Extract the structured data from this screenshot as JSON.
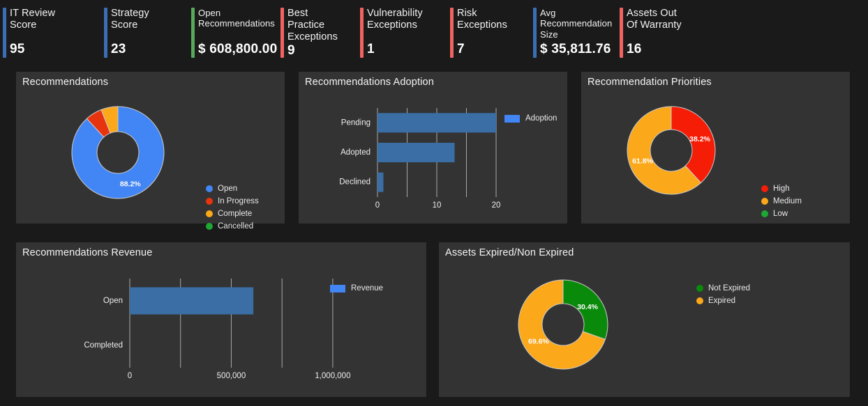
{
  "colors": {
    "page_bg": "#1a1a1a",
    "panel_bg": "#333333",
    "accent_blue": "#3b6fb5",
    "accent_green": "#5aa85a",
    "accent_red": "#ef6361",
    "bar_blue": "#3a6ea5",
    "legend_blue": "#4285f4",
    "legend_red": "#e8330f",
    "legend_orange": "#fba81a",
    "legend_green": "#1da834",
    "donut_green": "#0a8a0a",
    "grid": "#a8a8a8",
    "text": "#ededed"
  },
  "kpis": [
    {
      "label": "IT Review\nScore",
      "value": "95",
      "accent": "#3b6fb5",
      "label_size": "lg",
      "width": 145
    },
    {
      "label": "Strategy\nScore",
      "value": "23",
      "accent": "#3b6fb5",
      "label_size": "lg",
      "width": 125
    },
    {
      "label": "Open\nRecommendations",
      "value": "$ 608,800.00",
      "accent": "#5aa85a",
      "label_size": "sm",
      "width": 128
    },
    {
      "label": "Best\nPractice\nExceptions",
      "value": "9",
      "accent": "#ef6361",
      "label_size": "lg",
      "width": 114
    },
    {
      "label": "Vulnerability\nExceptions",
      "value": "1",
      "accent": "#ef6361",
      "label_size": "lg",
      "width": 129
    },
    {
      "label": "Risk\nExceptions",
      "value": "7",
      "accent": "#ef6361",
      "label_size": "lg",
      "width": 119
    },
    {
      "label": "Avg\nRecommendation\nSize",
      "value": "$ 35,811.76",
      "accent": "#3b6fb5",
      "label_size": "sm",
      "width": 124
    },
    {
      "label": "Assets Out\nOf Warranty",
      "value": "16",
      "accent": "#ef6361",
      "label_size": "lg",
      "width": 140
    }
  ],
  "panels": {
    "recommendations": {
      "title": "Recommendations"
    },
    "adoption": {
      "title": "Recommendations Adoption"
    },
    "priorities": {
      "title": "Recommendation Priorities"
    },
    "revenue": {
      "title": "Recommendations Revenue"
    },
    "assets": {
      "title": "Assets Expired/Non Expired"
    }
  },
  "chart_data": [
    {
      "id": "recommendations",
      "type": "pie",
      "title": "Recommendations",
      "legend_position": "right",
      "labels": [
        "Open",
        "In Progress",
        "Complete",
        "Cancelled"
      ],
      "values": [
        88.2,
        5.9,
        5.9,
        0
      ],
      "value_labels": [
        "88.2%",
        "",
        "",
        ""
      ],
      "colors": [
        "#4285f4",
        "#e8330f",
        "#fba81a",
        "#1da834"
      ]
    },
    {
      "id": "adoption",
      "type": "bar",
      "orientation": "horizontal",
      "title": "Recommendations Adoption",
      "categories": [
        "Pending",
        "Adopted",
        "Declined"
      ],
      "values": [
        20,
        13,
        1
      ],
      "series": [
        {
          "name": "Adoption",
          "values": [
            20,
            13,
            1
          ]
        }
      ],
      "xlim": [
        0,
        20
      ],
      "gridlines": [
        0,
        5,
        10,
        15,
        20
      ],
      "tick_labels": [
        "0",
        "10",
        "20"
      ],
      "tick_values": [
        0,
        10,
        20
      ],
      "legend_entries": [
        {
          "label": "Adoption",
          "color": "#4285f4"
        }
      ],
      "legend_position": "top-right",
      "bar_color": "#3a6ea5"
    },
    {
      "id": "priorities",
      "type": "pie",
      "title": "Recommendation Priorities",
      "legend_position": "right",
      "labels": [
        "High",
        "Medium",
        "Low"
      ],
      "values": [
        38.2,
        61.8,
        0
      ],
      "value_labels": [
        "38.2%",
        "61.8%",
        ""
      ],
      "colors": [
        "#f51d06",
        "#fba81a",
        "#1da834"
      ]
    },
    {
      "id": "revenue",
      "type": "bar",
      "orientation": "horizontal",
      "title": "Recommendations Revenue",
      "categories": [
        "Open",
        "Completed"
      ],
      "values": [
        608800,
        0
      ],
      "series": [
        {
          "name": "Revenue",
          "values": [
            608800,
            0
          ]
        }
      ],
      "xlim": [
        0,
        1100000
      ],
      "gridlines": [
        0,
        250000,
        500000,
        750000,
        1000000
      ],
      "tick_labels": [
        "0",
        "500,000",
        "1,000,000"
      ],
      "tick_values": [
        0,
        500000,
        1000000
      ],
      "legend_entries": [
        {
          "label": "Revenue",
          "color": "#4285f4"
        }
      ],
      "legend_position": "top-right",
      "bar_color": "#3a6ea5"
    },
    {
      "id": "assets",
      "type": "pie",
      "title": "Assets Expired/Non Expired",
      "legend_position": "right",
      "labels": [
        "Not Expired",
        "Expired"
      ],
      "values": [
        30.4,
        69.6
      ],
      "value_labels": [
        "30.4%",
        "69.6%"
      ],
      "colors": [
        "#0a8a0a",
        "#fba81a"
      ]
    }
  ]
}
